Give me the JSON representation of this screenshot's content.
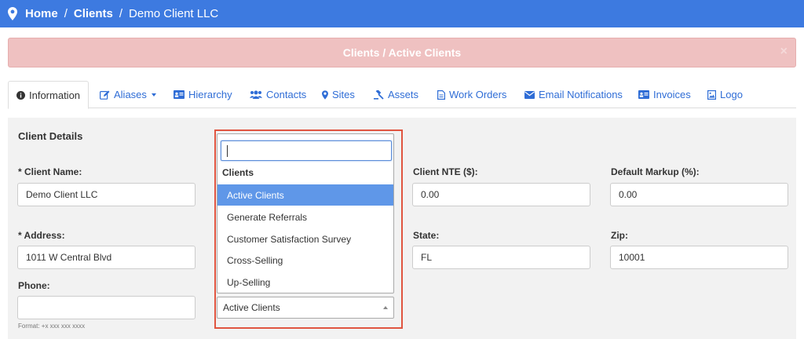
{
  "breadcrumb": {
    "home": "Home",
    "clients": "Clients",
    "current": "Demo Client LLC",
    "separator": "/"
  },
  "alert": {
    "text": "Clients / Active Clients",
    "close": "×"
  },
  "tabs": [
    {
      "label": "Information",
      "icon": "info-icon"
    },
    {
      "label": "Aliases",
      "icon": "edit-icon"
    },
    {
      "label": "Hierarchy",
      "icon": "id-card-icon"
    },
    {
      "label": "Contacts",
      "icon": "users-icon"
    },
    {
      "label": "Sites",
      "icon": "map-marker-icon"
    },
    {
      "label": "Assets",
      "icon": "gavel-icon"
    },
    {
      "label": "Work Orders",
      "icon": "file-icon"
    },
    {
      "label": "Email Notifications",
      "icon": "envelope-icon"
    },
    {
      "label": "Invoices",
      "icon": "id-card-icon"
    },
    {
      "label": "Logo",
      "icon": "image-icon"
    }
  ],
  "panel": {
    "title": "Client Details"
  },
  "fields": {
    "client_name": {
      "label": "* Client Name:",
      "value": "Demo Client LLC"
    },
    "client_nte": {
      "label": "Client NTE ($):",
      "value": "0.00"
    },
    "default_markup": {
      "label": "Default Markup (%):",
      "value": "0.00"
    },
    "address": {
      "label": "* Address:",
      "value": "1011 W Central Blvd"
    },
    "state": {
      "label": "State:",
      "value": "FL"
    },
    "zip": {
      "label": "Zip:",
      "value": "10001"
    },
    "phone": {
      "label": "Phone:",
      "value": "",
      "hint": "Format: +x xxx xxx xxxx"
    }
  },
  "dropdown": {
    "search_value": "",
    "group_label": "Clients",
    "options": [
      "Active Clients",
      "Generate Referrals",
      "Customer Satisfaction Survey",
      "Cross-Selling",
      "Up-Selling"
    ],
    "highlighted": "Active Clients",
    "selected": "Active Clients"
  },
  "colors": {
    "topbar": "#3d7ae0",
    "alert_bg": "#efc1c1",
    "link": "#2f6dd6",
    "highlight": "#5f97e8",
    "annotation_border": "#e05540"
  }
}
